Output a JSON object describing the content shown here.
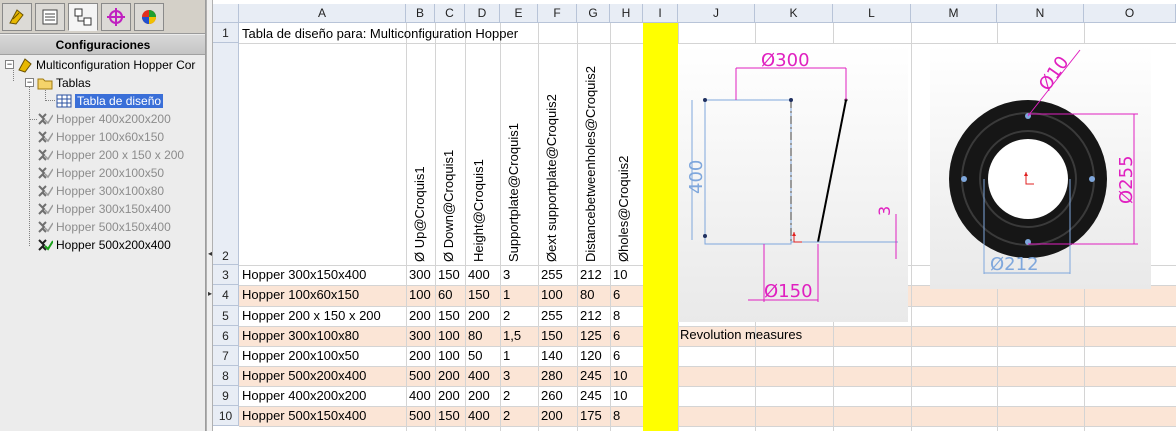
{
  "panel": {
    "title": "Configuraciones",
    "tabs": [
      {
        "icon": "feature-manager-icon"
      },
      {
        "icon": "property-manager-icon"
      },
      {
        "icon": "configuration-manager-icon",
        "active": true
      },
      {
        "icon": "dimxpert-icon"
      },
      {
        "icon": "display-manager-icon"
      }
    ],
    "tree": {
      "root": "Multiconfiguration Hopper Cor",
      "tables": "Tablas",
      "design_table": "Tabla de diseño",
      "configs": [
        {
          "label": "Hopper  400x200x200",
          "active": false
        },
        {
          "label": "Hopper 100x60x150",
          "active": false
        },
        {
          "label": "Hopper 200 x 150 x 200",
          "active": false
        },
        {
          "label": "Hopper 200x100x50",
          "active": false
        },
        {
          "label": "Hopper 300x100x80",
          "active": false
        },
        {
          "label": "Hopper 300x150x400",
          "active": false
        },
        {
          "label": "Hopper 500x150x400",
          "active": false
        },
        {
          "label": "Hopper 500x200x400",
          "active": true
        }
      ]
    }
  },
  "sheet": {
    "columns": [
      "A",
      "B",
      "C",
      "D",
      "E",
      "F",
      "G",
      "H",
      "I",
      "J",
      "K",
      "L",
      "M",
      "N",
      "O"
    ],
    "rows": [
      "1",
      "2",
      "3",
      "4",
      "5",
      "6",
      "7",
      "8",
      "9",
      "10"
    ],
    "title": "Tabla de diseño para: Multiconfiguration Hopper",
    "headers": [
      "Ø Up@Croquis1",
      "Ø Down@Croquis1",
      "Height@Croquis1",
      "Supportplate@Croquis1",
      "Øext supportplate@Croquis2",
      "Distancebetweenholes@Croquis2",
      "Øholes@Croquis2"
    ],
    "data": [
      [
        "Hopper 300x150x400",
        "300",
        "150",
        "400",
        "3",
        "255",
        "212",
        "10"
      ],
      [
        "Hopper 100x60x150",
        "100",
        "60",
        "150",
        "1",
        "100",
        "80",
        "6"
      ],
      [
        "Hopper 200 x 150 x 200",
        "200",
        "150",
        "200",
        "2",
        "255",
        "212",
        "8"
      ],
      [
        "Hopper 300x100x80",
        "300",
        "100",
        "80",
        "1,5",
        "150",
        "125",
        "6"
      ],
      [
        "Hopper 200x100x50",
        "200",
        "100",
        "50",
        "1",
        "140",
        "120",
        "6"
      ],
      [
        "Hopper 500x200x400",
        "500",
        "200",
        "400",
        "3",
        "280",
        "245",
        "10"
      ],
      [
        "Hopper  400x200x200",
        "400",
        "200",
        "200",
        "2",
        "260",
        "245",
        "10"
      ],
      [
        "Hopper 500x150x400",
        "500",
        "150",
        "400",
        "2",
        "200",
        "175",
        "8"
      ]
    ],
    "note": "Revolution measures",
    "highlight_color": "#ffff00",
    "band_color": "#fbe5d6"
  },
  "drawing1": {
    "dim_up": "Ø300",
    "dim_height": "400",
    "dim_support": "3",
    "dim_down": "Ø150"
  },
  "drawing2": {
    "dim_holes": "Ø10",
    "dim_ext": "Ø255",
    "dim_between": "Ø212"
  }
}
